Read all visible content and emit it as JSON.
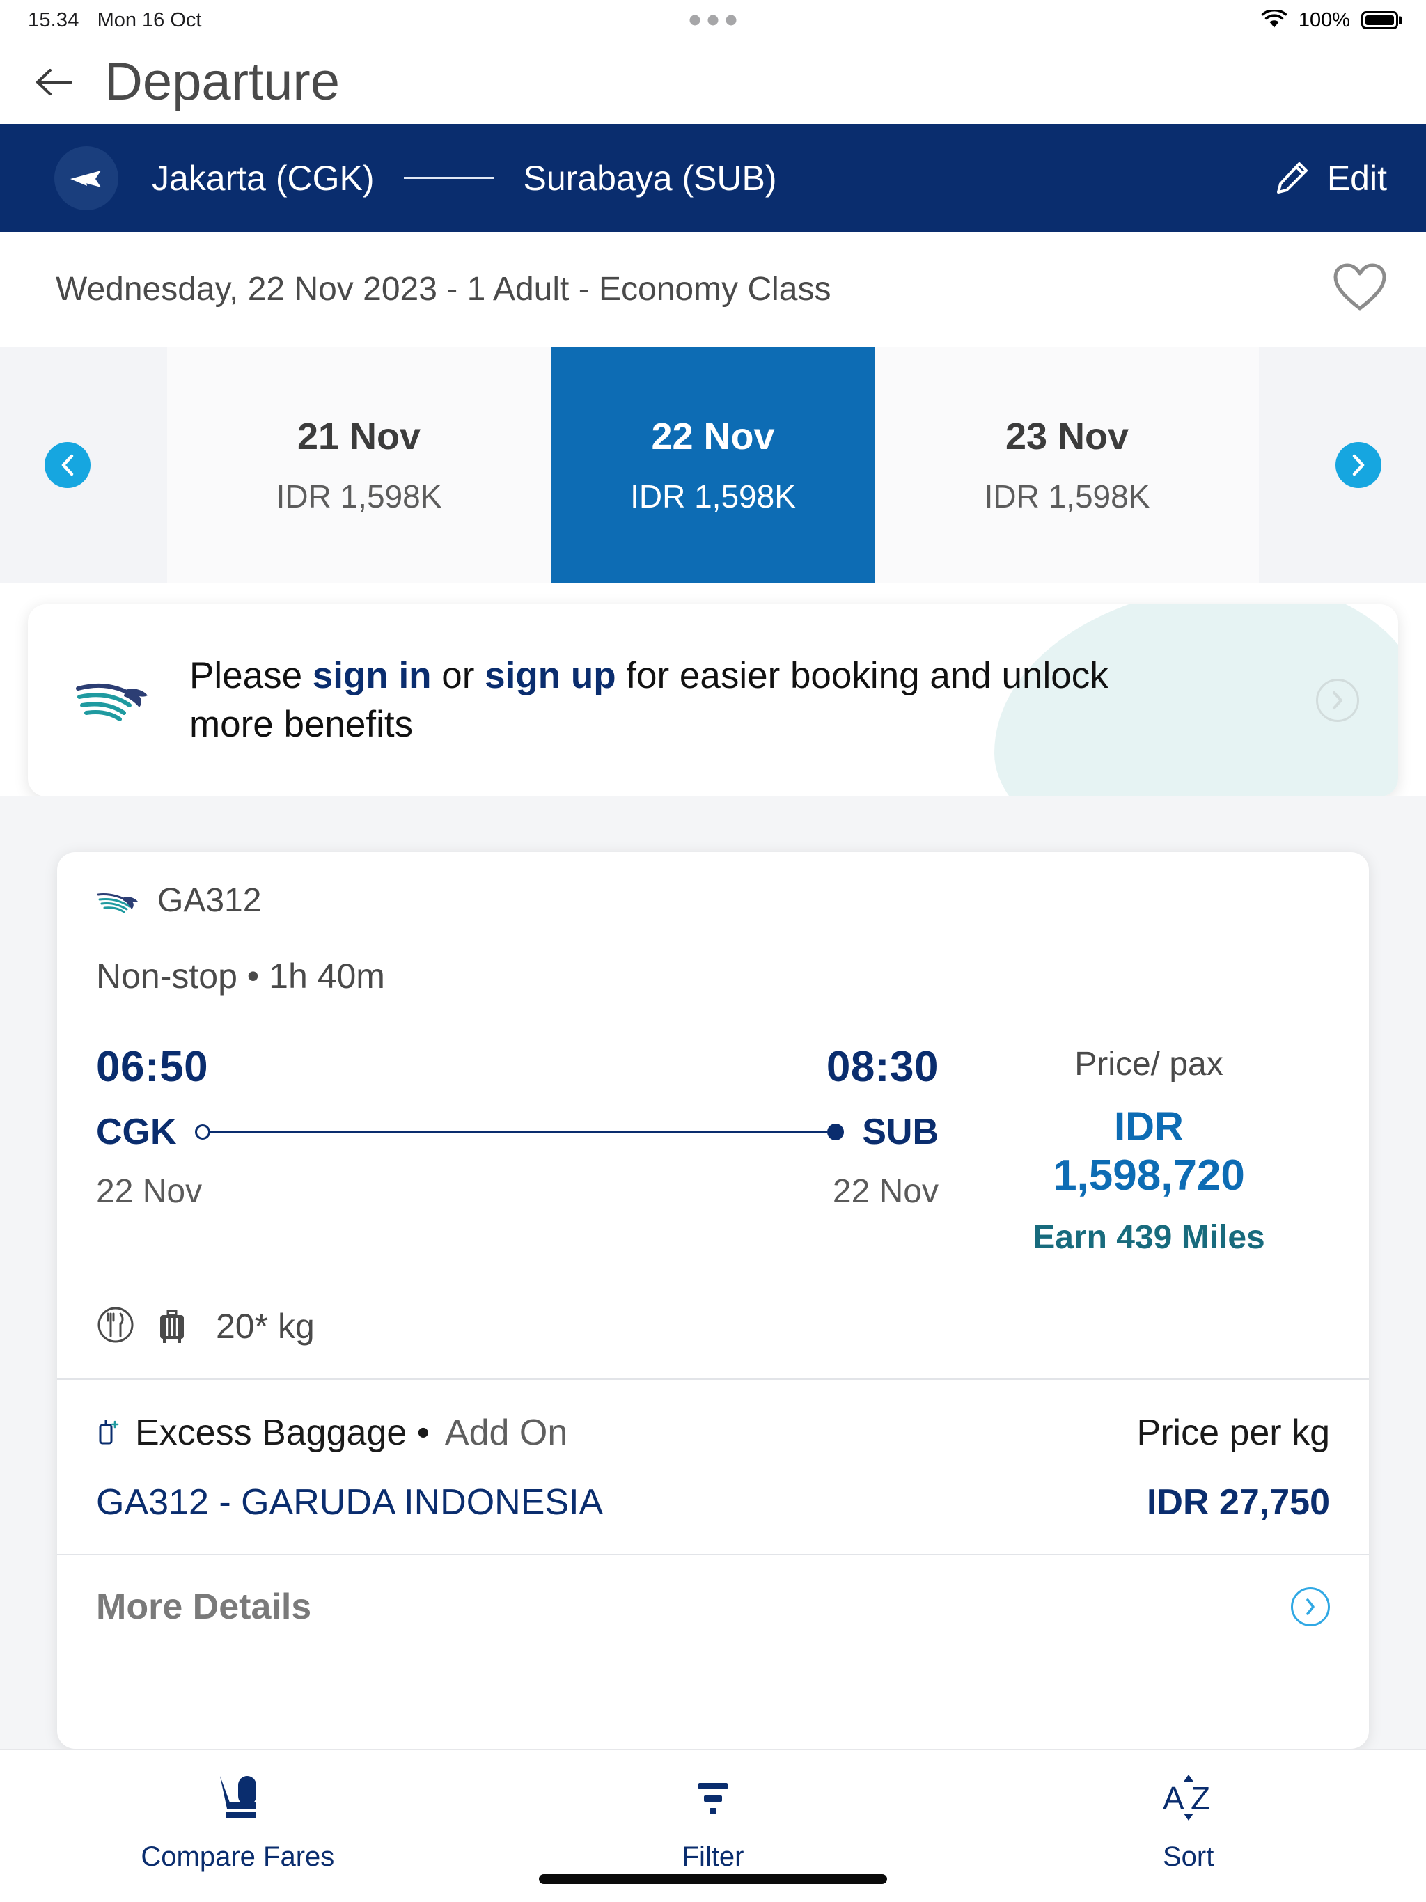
{
  "statusbar": {
    "time": "15.34",
    "date": "Mon 16 Oct",
    "battery_pct": "100%",
    "wifi_icon": "wifi-icon",
    "battery_icon": "battery-full-icon",
    "menu_icon": "ellipsis-icon"
  },
  "header": {
    "back_icon": "back-arrow-icon",
    "title": "Departure"
  },
  "route": {
    "plane_icon": "airplane-icon",
    "origin": "Jakarta (CGK)",
    "destination": "Surabaya (SUB)",
    "edit_label": "Edit",
    "edit_icon": "pencil-icon",
    "bar_color": "#0a2d6e"
  },
  "search_summary": {
    "text": "Wednesday, 22 Nov 2023 - 1 Adult - Economy Class",
    "favorite_icon": "heart-outline-icon"
  },
  "date_strip": {
    "prev_icon": "chevron-left-icon",
    "next_icon": "chevron-right-icon",
    "active_color": "#0d6cb4",
    "nav_color": "#16a6e0",
    "days": [
      {
        "day": "21 Nov",
        "price": "IDR 1,598K",
        "active": false
      },
      {
        "day": "22 Nov",
        "price": "IDR 1,598K",
        "active": true
      },
      {
        "day": "23 Nov",
        "price": "IDR 1,598K",
        "active": false
      }
    ]
  },
  "signin_banner": {
    "logo_icon": "garuda-logo-icon",
    "text_part1": "Please ",
    "link_signin": "sign in",
    "text_part2": " or ",
    "link_signup": "sign up",
    "text_part3": " for easier booking and unlock more benefits",
    "chevron_icon": "chevron-right-circle-icon",
    "link_color": "#0a2d6e"
  },
  "flight_card": {
    "airline_icon": "garuda-bird-icon",
    "flight_number": "GA312",
    "subtitle": "Non-stop • 1h 40m",
    "depart_time": "06:50",
    "arrive_time": "08:30",
    "depart_code": "CGK",
    "arrive_code": "SUB",
    "depart_date": "22 Nov",
    "arrive_date": "22 Nov",
    "price_label": "Price/ pax",
    "currency": "IDR",
    "amount": "1,598,720",
    "miles": "Earn 439 Miles",
    "meal_icon": "meal-icon",
    "baggage_icon": "suitcase-icon",
    "baggage_allowance": "20* kg",
    "excess_baggage_icon": "baggage-add-icon",
    "excess_baggage_label": "Excess Baggage • ",
    "excess_baggage_addon": "Add On",
    "price_per_kg_label": "Price per kg",
    "excess_airline": "GA312 - GARUDA INDONESIA",
    "excess_price": "IDR 27,750",
    "more_details_label": "More Details",
    "more_details_icon": "chevron-right-circle-icon",
    "price_color": "#0d6cb4",
    "navy": "#0a2d6e",
    "miles_color": "#186b7d"
  },
  "bottom_nav": {
    "items": [
      {
        "label": "Compare Fares",
        "icon": "seat-icon"
      },
      {
        "label": "Filter",
        "icon": "filter-icon"
      },
      {
        "label": "Sort",
        "icon": "sort-az-icon"
      }
    ],
    "color": "#0a2d6e"
  }
}
